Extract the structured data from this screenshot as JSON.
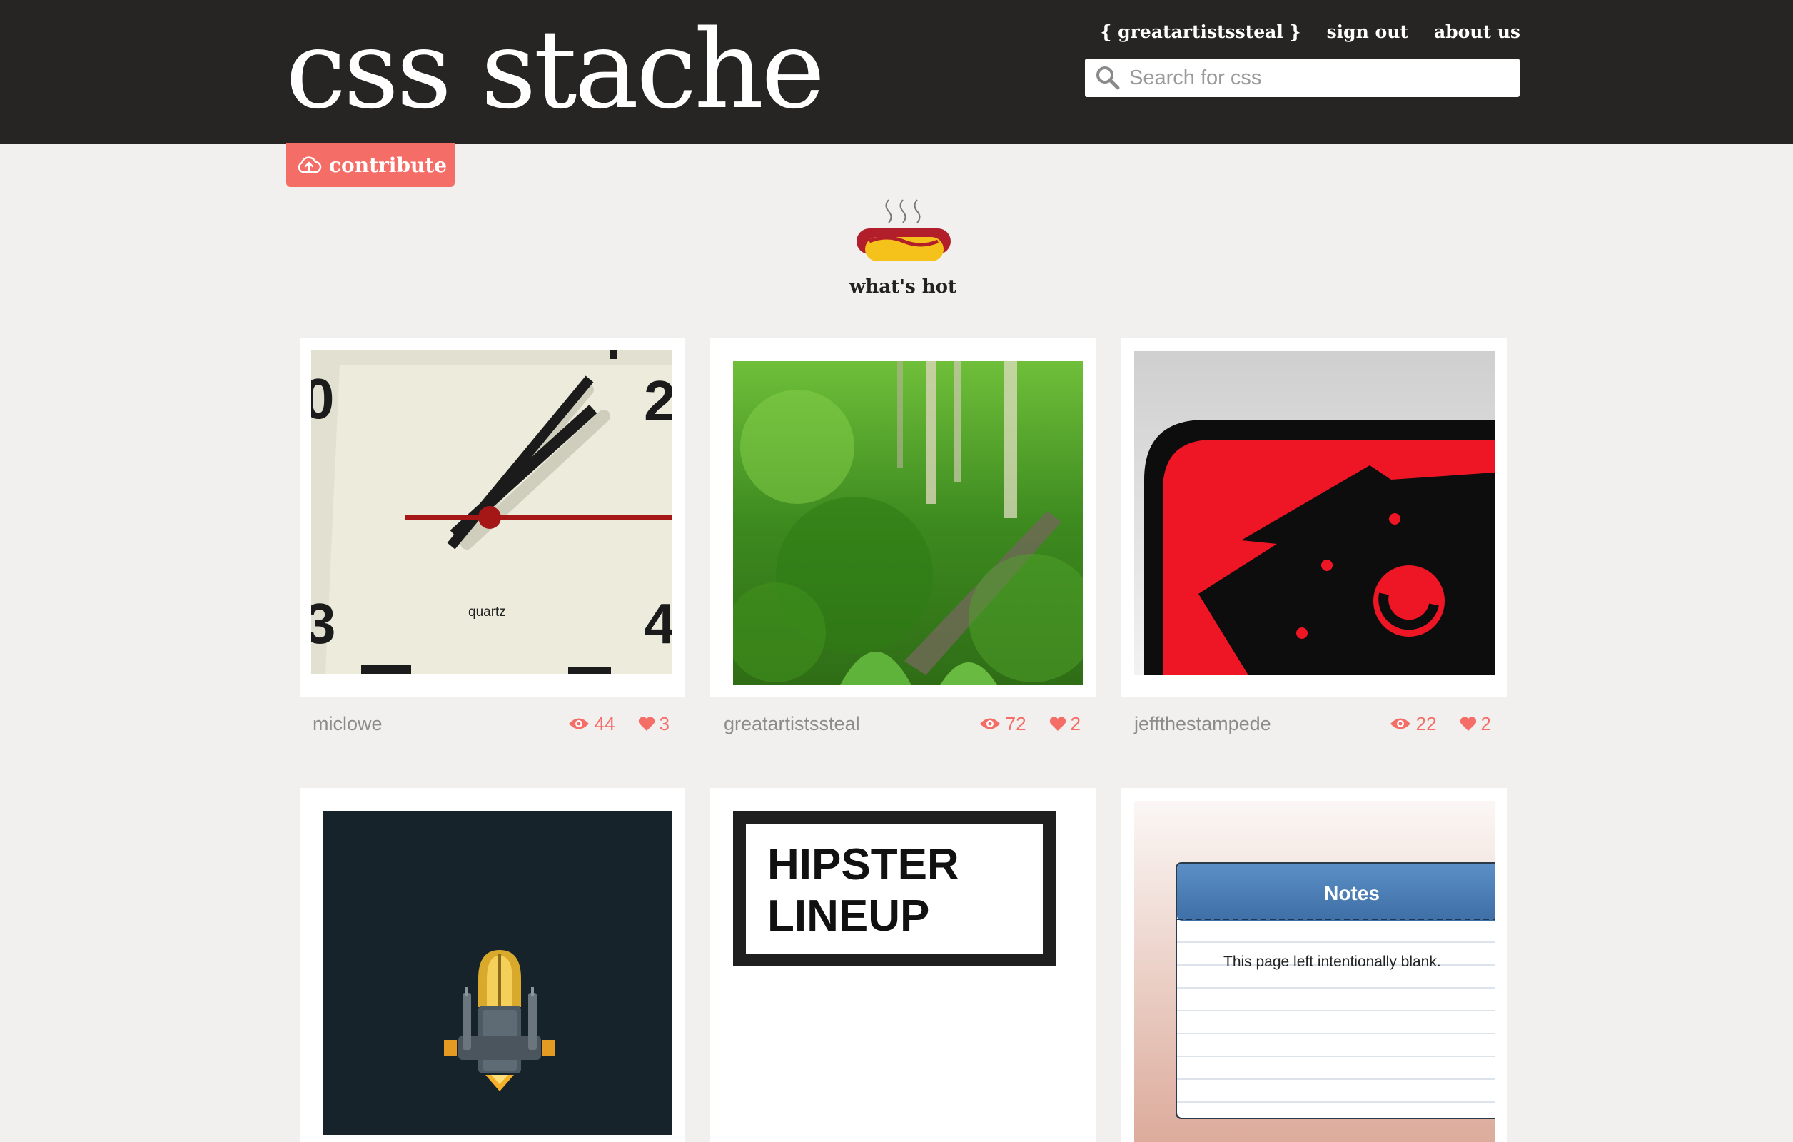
{
  "header": {
    "logo": "css stache",
    "nav": [
      "{ greatartistssteal }",
      "sign out",
      "about us"
    ],
    "search_placeholder": "Search for css"
  },
  "contribute_label": "contribute",
  "hot_label": "what's hot",
  "colors": {
    "header_bg": "#272523",
    "accent": "#f46d67",
    "page_bg": "#f1f0ee"
  },
  "cards": [
    {
      "user": "miclowe",
      "views": "44",
      "likes": "3",
      "thumb_text": "quartz"
    },
    {
      "user": "greatartistssteal",
      "views": "72",
      "likes": "2"
    },
    {
      "user": "jeffthestampede",
      "views": "22",
      "likes": "2"
    },
    {
      "user": "",
      "views": "",
      "likes": ""
    },
    {
      "user": "",
      "views": "",
      "likes": "",
      "thumb_text": "HIPSTER LINEUP"
    },
    {
      "user": "",
      "views": "",
      "likes": "",
      "notes_title": "Notes",
      "notes_text": "This page left intentionally blank."
    }
  ]
}
